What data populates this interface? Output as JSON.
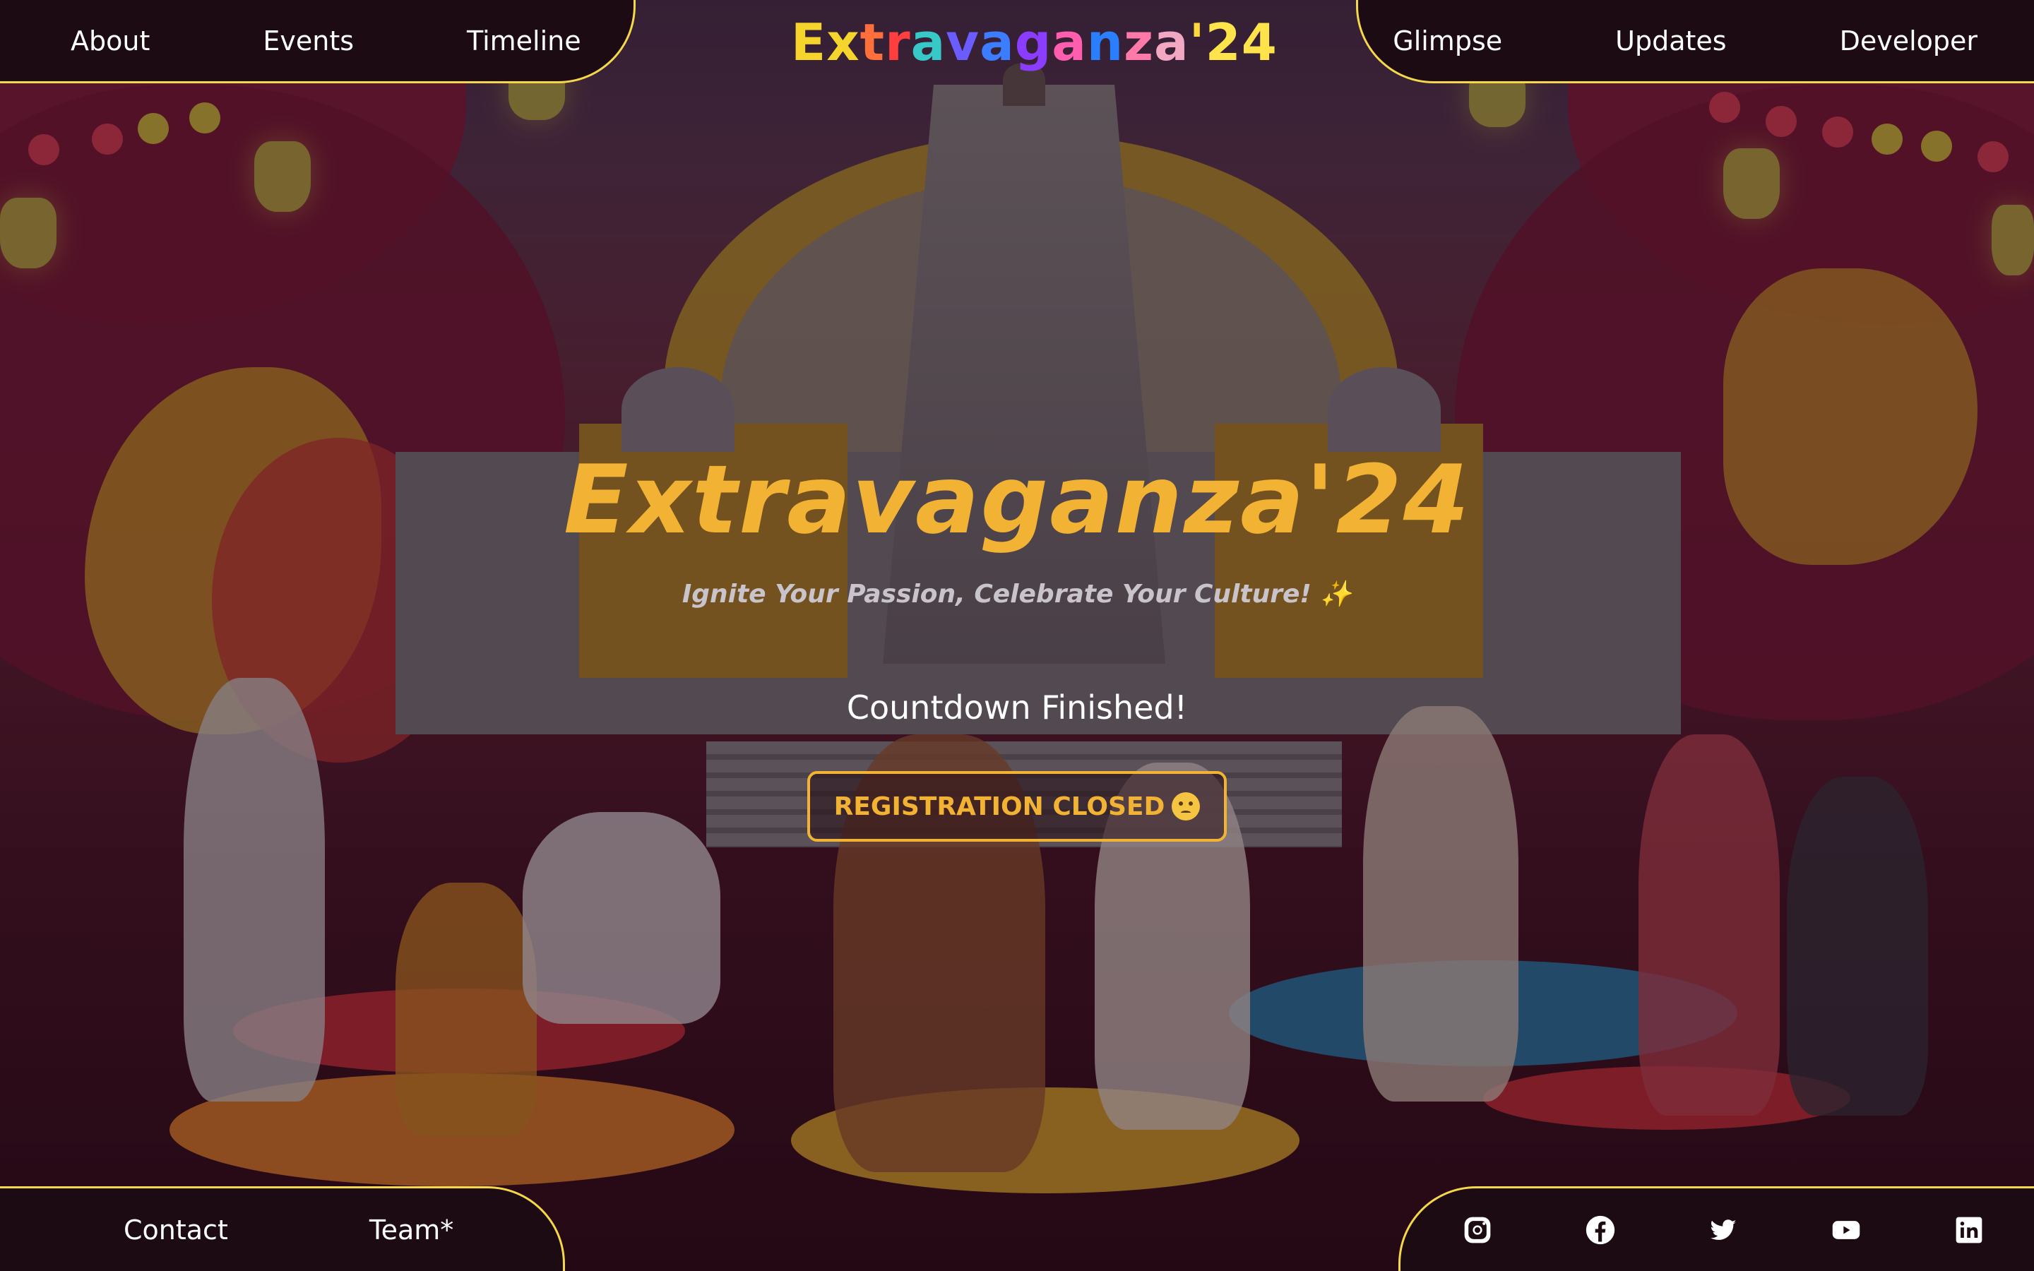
{
  "nav_top_left": {
    "items": [
      {
        "label": "About"
      },
      {
        "label": "Events"
      },
      {
        "label": "Timeline"
      }
    ]
  },
  "nav_top_right": {
    "items": [
      {
        "label": "Glimpse"
      },
      {
        "label": "Updates"
      },
      {
        "label": "Developer"
      }
    ]
  },
  "brand": {
    "text": "Extravaganza'24",
    "letter_colors": [
      "#f5d42c",
      "#f5d42c",
      "#ff6f3c",
      "#ff3e3e",
      "#37c8c8",
      "#6b5cff",
      "#3c7cff",
      "#8a3cff",
      "#ff5eae",
      "#2a7fff",
      "#ff7aa8",
      "#f2a7c3",
      "#ffd93b",
      "#ffe34a",
      "#ffe34a"
    ]
  },
  "hero": {
    "title": "Extravaganza'24",
    "subtitle": "Ignite Your Passion, Celebrate Your Culture! ✨",
    "countdown": "Countdown Finished!",
    "registration_label": "REGISTRATION CLOSED",
    "registration_emoji": "crying-face-icon"
  },
  "nav_bottom_left": {
    "items": [
      {
        "label": "Contact"
      },
      {
        "label": "Team*"
      }
    ]
  },
  "nav_bottom_right": {
    "social": [
      "instagram-icon",
      "facebook-icon",
      "twitter-icon",
      "youtube-icon",
      "linkedin-icon"
    ]
  },
  "colors": {
    "accent": "#f2b233",
    "nav_border": "#f4d84a",
    "nav_bg": "#1c0b12"
  }
}
